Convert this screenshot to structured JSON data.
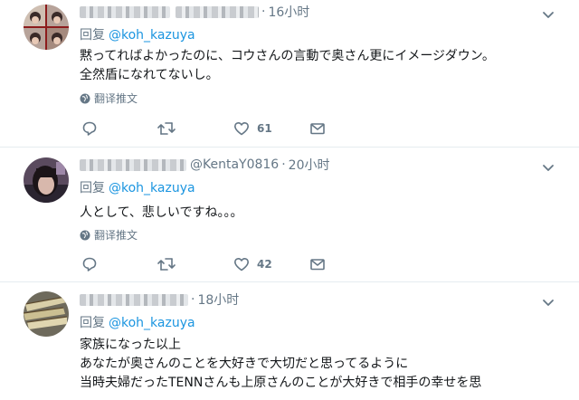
{
  "tweets": [
    {
      "time": "16小时",
      "reply_prefix": "回复",
      "reply_to": "@koh_kazuya",
      "text_lines": [
        "黙ってればよかったのに、コウさんの言動で奥さん更にイメージダウン。",
        "全然盾になれてないし。"
      ],
      "translate_label": "翻译推文",
      "like_count": "61"
    },
    {
      "handle": "@KentaY0816",
      "time": "20小时",
      "reply_prefix": "回复",
      "reply_to": "@koh_kazuya",
      "text_lines": [
        "人として、悲しいですね。。。"
      ],
      "translate_label": "翻译推文",
      "like_count": "42"
    },
    {
      "time": "18小时",
      "reply_prefix": "回复",
      "reply_to": "@koh_kazuya",
      "text_lines": [
        "家族になった以上",
        "あなたが奥さんのことを大好きで大切だと思ってるように",
        "当時夫婦だったTENNさんも上原さんのことが大好きで相手の幸せを思"
      ]
    }
  ],
  "colors": {
    "accent": "#1b95e0",
    "secondary": "#657786",
    "text": "#14171a",
    "border": "#e6ecf0"
  },
  "icons": [
    "chevron-down-icon",
    "globe-icon",
    "reply-icon",
    "retweet-icon",
    "like-icon",
    "message-icon"
  ]
}
